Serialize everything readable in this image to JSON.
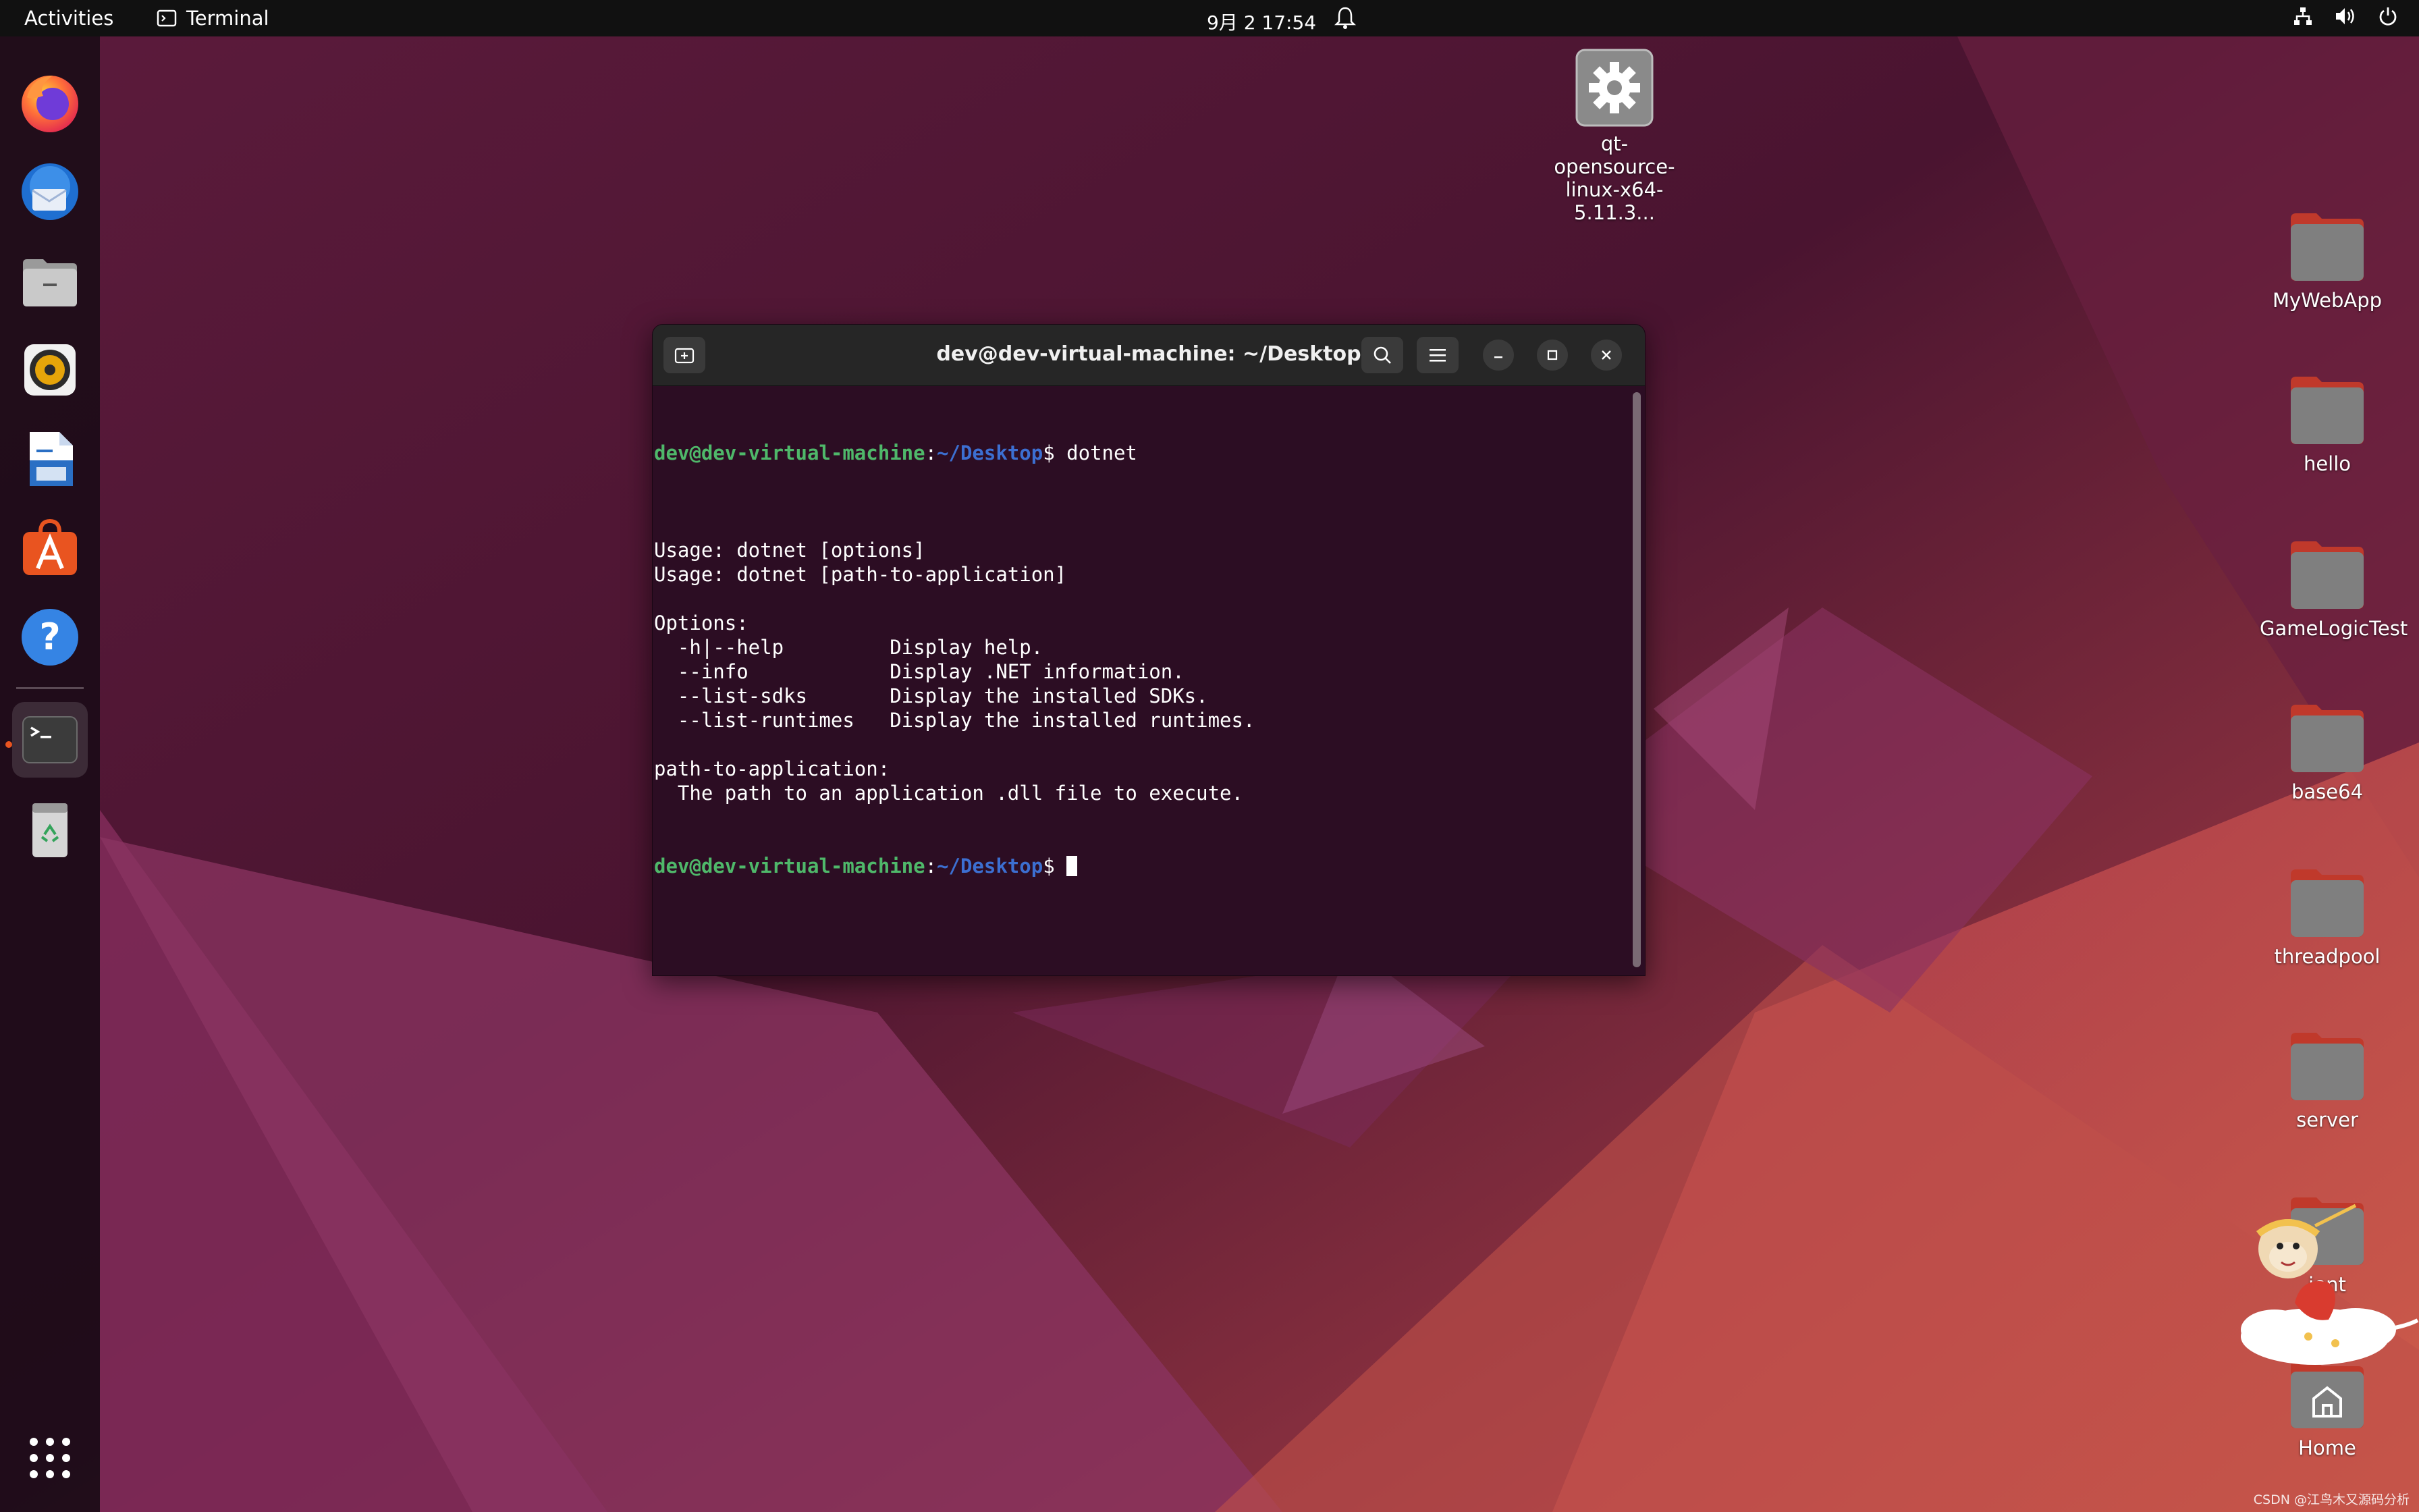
{
  "topbar": {
    "activities": "Activities",
    "app_name": "Terminal",
    "clock": "9月 2  17:54"
  },
  "dock": {
    "items": [
      {
        "name": "Firefox"
      },
      {
        "name": "Thunderbird"
      },
      {
        "name": "Files"
      },
      {
        "name": "Rhythmbox"
      },
      {
        "name": "LibreOffice Writer"
      },
      {
        "name": "Ubuntu Software"
      },
      {
        "name": "Help"
      },
      {
        "name": "Terminal"
      },
      {
        "name": "Trash"
      },
      {
        "name": "Show Applications"
      }
    ]
  },
  "desktop": {
    "qt_installer": {
      "line1": "qt-opensource-",
      "line2": "linux-x64-5.11.3..."
    },
    "folders": [
      "MyWebApp",
      "hello",
      "GameLogicTest",
      "base64",
      "threadpool",
      "server",
      "ient",
      "Home"
    ]
  },
  "terminal": {
    "title": "dev@dev-virtual-machine: ~/Desktop",
    "prompt_user": "dev@dev-virtual-machine",
    "prompt_sep": ":",
    "prompt_path": "~/Desktop",
    "prompt_sym": "$",
    "command": " dotnet",
    "output": [
      "",
      "Usage: dotnet [options]",
      "Usage: dotnet [path-to-application]",
      "",
      "Options:",
      "  -h|--help         Display help.",
      "  --info            Display .NET information.",
      "  --list-sdks       Display the installed SDKs.",
      "  --list-runtimes   Display the installed runtimes.",
      "",
      "path-to-application:",
      "  The path to an application .dll file to execute."
    ]
  },
  "watermark": "CSDN @江鸟木又源码分析",
  "colors": {
    "accent": "#e95420",
    "terminal_bg": "#2c0d23",
    "prompt_user": "#4fb86a",
    "prompt_path": "#3c6fd1"
  }
}
